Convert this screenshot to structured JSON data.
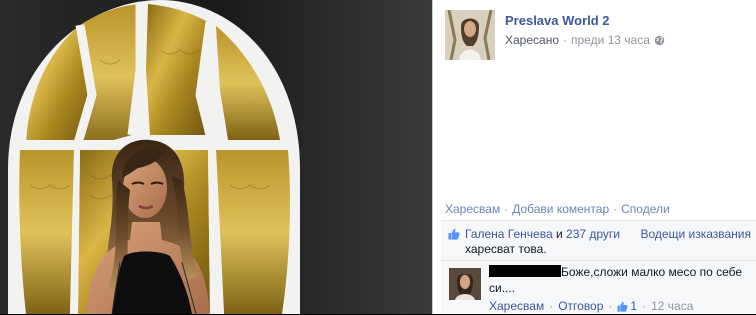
{
  "post": {
    "author": "Preslava World 2",
    "liked_label": "Харесано",
    "separator": "·",
    "time": "преди 13 часа",
    "audience_icon": "globe-icon"
  },
  "actions": {
    "like": "Харесвам",
    "comment": "Добави коментар",
    "share": "Сподели",
    "separator": "·"
  },
  "likes": {
    "first_name": "Галена Генчева",
    "joiner": " и ",
    "others": "237 други",
    "suffix": " харесват това.",
    "translations": "Водещи изказвания",
    "icon": "thumbs-up-icon"
  },
  "comment": {
    "author_redacted": true,
    "text": "Боже,сложи малко месо по себе си....",
    "like": "Харесвам",
    "reply": "Отговор",
    "like_count": "1",
    "time": "12 часа",
    "separator": "·"
  },
  "colors": {
    "link": "#3b5998",
    "muted": "#90949c",
    "gold": "#c9a227",
    "throne_frame": "#f2f2f0"
  }
}
